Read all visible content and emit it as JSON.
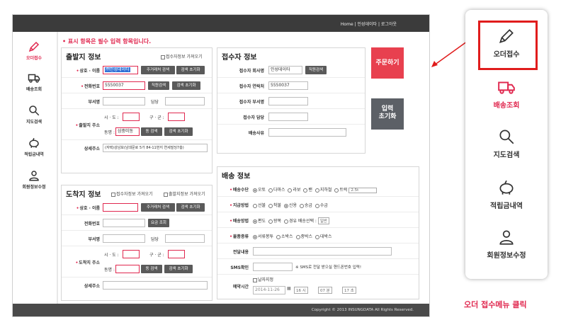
{
  "topbar": {
    "links": "Home | 인성데이타 | 로그아웃"
  },
  "footer": {
    "copyright": "Copyright © 2013 INSUNGDATA All Rights Reserved."
  },
  "nav": [
    {
      "label": "오더접수",
      "icon": "pencil-icon"
    },
    {
      "label": "배송조회",
      "icon": "truck-icon"
    },
    {
      "label": "지도검색",
      "icon": "search-icon"
    },
    {
      "label": "적립금내역",
      "icon": "piggy-bank-icon"
    },
    {
      "label": "회원정보수정",
      "icon": "user-icon"
    }
  ],
  "notice": "• 표시 항목은 필수 입력 항목입니다.",
  "origin": {
    "title": "출발지 정보",
    "option": "접수자정보 가져오기",
    "fields": {
      "name_label": "상호 · 이름",
      "name_value": "㈜인성데이타",
      "phone_label": "전화번호",
      "phone_value": "5550037",
      "dept_label": "부서명",
      "manager_label": "담당",
      "addr_label": "출발지 주소",
      "city_label": "시 · 도 :",
      "gu_label": "구 · 군 :",
      "dong_label": "동명 :",
      "dong_value": "삼중미동",
      "detail_label": "상세주소",
      "detail_value": "(자택)강남보(남대문로 5가 84-11번지 연세빌딩7층)"
    },
    "buttons": {
      "customer_search": "주거래처 검색",
      "search_reset": "검색 초기화",
      "staff_search": "직원검색",
      "dong_search": "동 검색"
    }
  },
  "dest": {
    "title": "도착지 정보",
    "option1": "접수자정보 가져오기",
    "option2": "출발지정보 가져오기",
    "fields": {
      "name_label": "상호 · 이름",
      "phone_label": "전화번호",
      "dept_label": "부서명",
      "manager_label": "담당",
      "addr_label": "도착지 주소",
      "city_label": "시 · 도 :",
      "gu_label": "구 · 군 :",
      "dong_label": "동명 :",
      "detail_label": "상세주소"
    },
    "buttons": {
      "customer_search": "주거래처 검색",
      "search_reset": "검색 초기화",
      "fee_lookup": "요금 조회",
      "dong_search": "동 검색"
    }
  },
  "receiver": {
    "title": "접수자 정보",
    "company_label": "접수자 회사명",
    "company_value": "인성데이타",
    "contact_label": "접수자 연락처",
    "contact_value": "5550037",
    "dept_label": "접수자 부서명",
    "manager_label": "접수자 담당",
    "reason_label": "배송사유",
    "staff_search": "직원검색"
  },
  "actions": {
    "order": "주문하기",
    "reset_line1": "입력",
    "reset_line2": "초기화"
  },
  "delivery": {
    "title": "배송 정보",
    "method_label": "배송수단",
    "methods": [
      "오토",
      "다마스",
      "라보",
      "밴",
      "지하철",
      "트럭"
    ],
    "truck_select": "2.5t",
    "pay_label": "지급방법",
    "pays": [
      "선불",
      "착불",
      "신용",
      "송금",
      "수금"
    ],
    "type_label": "배송방법",
    "types": [
      "편도",
      "왕복",
      "경유 배송선택 :"
    ],
    "type_select": "일반",
    "item_label": "물품종류",
    "items": [
      "서류봉투",
      "소박스",
      "중박스",
      "대박스"
    ],
    "memo_label": "전달내용",
    "sms_label": "SMS확인",
    "sms_note": "※ SMS로 전달 받으실 핸드폰번호 입력!",
    "reserve_label": "예약시간",
    "reserve_check": "날자지정",
    "date_value": "2014-11-26",
    "hour": "16 시",
    "minute": "07 분",
    "second": "17 초"
  },
  "callout": {
    "items": [
      {
        "label": "오더접수",
        "icon": "pencil-icon"
      },
      {
        "label": "배송조회",
        "icon": "truck-icon"
      },
      {
        "label": "지도검색",
        "icon": "search-icon"
      },
      {
        "label": "적립금내역",
        "icon": "piggy-bank-icon"
      },
      {
        "label": "회원정보수정",
        "icon": "user-icon"
      }
    ],
    "caption": "오더 접수메뉴 클릭"
  },
  "colors": {
    "accent": "#e0284f",
    "highlight_box": "#e01c1c",
    "order_button": "#e8404f",
    "reset_button": "#5c6066",
    "topbar": "#3b3b3b"
  }
}
